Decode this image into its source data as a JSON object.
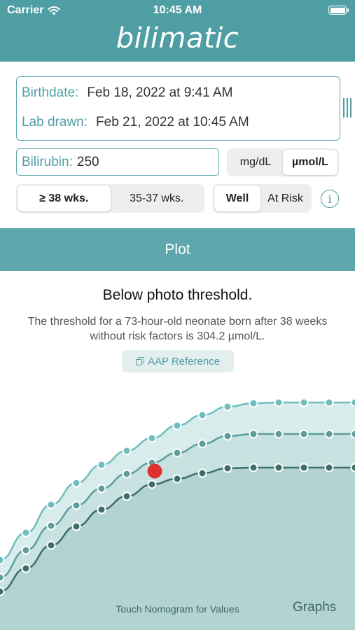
{
  "status_bar": {
    "carrier": "Carrier",
    "time": "10:45 AM"
  },
  "app": {
    "title": "bilimatic"
  },
  "inputs": {
    "birthdate_label": "Birthdate:",
    "birthdate_value": "Feb 18, 2022 at 9:41 AM",
    "lab_label": "Lab drawn:",
    "lab_value": "Feb 21, 2022 at 10:45 AM",
    "bilirubin_label": "Bilirubin:",
    "bilirubin_value": "250",
    "units": {
      "options": [
        "mg/dL",
        "µmol/L"
      ],
      "selected": "µmol/L"
    },
    "gestation": {
      "options": [
        "≥ 38 wks.",
        "35-37 wks."
      ],
      "selected": "≥ 38 wks."
    },
    "risk": {
      "options": [
        "Well",
        "At Risk"
      ],
      "selected": "Well"
    },
    "info_glyph": "i"
  },
  "plot_button": "Plot",
  "result": {
    "title": "Below photo threshold.",
    "description": "The threshold for a 73-hour-old neonate born after 38 weeks without risk factors is 304.2 µmol/L.",
    "reference_button": "AAP Reference",
    "reference_icon": "copy-icon"
  },
  "nomogram": {
    "hint": "Touch Nomogram for Values",
    "graphs_button": "Graphs",
    "colors": {
      "band_light": "#d9ecec",
      "band_mid": "#c8e1e1",
      "band_dark": "#b3d3d2",
      "upper": "#6fbdbd",
      "middle": "#5d9e9c",
      "lower": "#3f6d6a",
      "patient": "#e03030"
    },
    "patient_point": {
      "age_hours": 73,
      "bilirubin_umol": 250
    }
  },
  "colors": {
    "accent": "#4f9ea3",
    "plot_bar": "#5ea7ac"
  }
}
